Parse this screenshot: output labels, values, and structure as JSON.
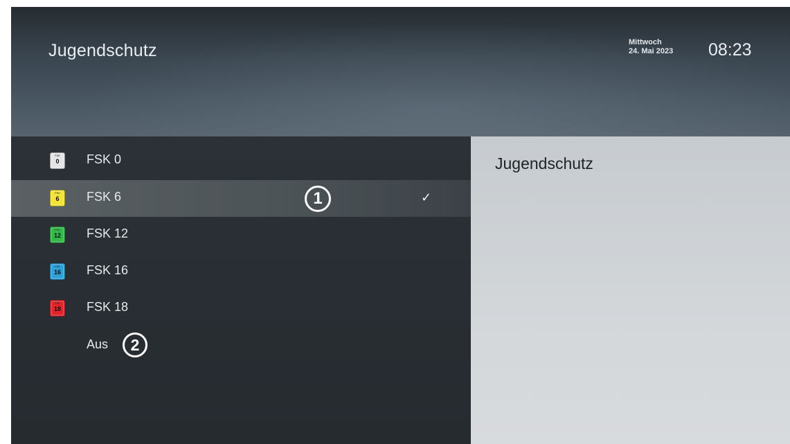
{
  "header": {
    "title": "Jugendschutz",
    "weekday": "Mittwoch",
    "date": "24. Mai 2023",
    "time": "08:23"
  },
  "menu": {
    "items": [
      {
        "label": "FSK 0",
        "badge": "0",
        "badge_color": "#e3e5e6",
        "selected": false
      },
      {
        "label": "FSK 6",
        "badge": "6",
        "badge_color": "#f2e23a",
        "selected": true
      },
      {
        "label": "FSK 12",
        "badge": "12",
        "badge_color": "#35b84a",
        "selected": false
      },
      {
        "label": "FSK 16",
        "badge": "16",
        "badge_color": "#2fa0d8",
        "selected": false
      },
      {
        "label": "FSK 18",
        "badge": "18",
        "badge_color": "#e0252b",
        "selected": false
      },
      {
        "label": "Aus",
        "badge": null,
        "selected": false
      }
    ],
    "badge_caption": "FSK",
    "check_symbol": "✓"
  },
  "info": {
    "title": "Jugendschutz"
  },
  "annotations": [
    {
      "number": "1"
    },
    {
      "number": "2"
    }
  ]
}
